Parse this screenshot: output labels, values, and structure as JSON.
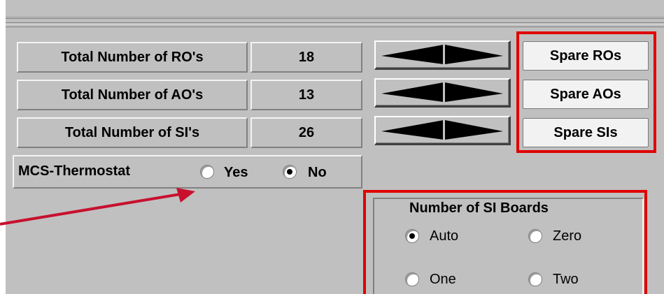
{
  "rows": [
    {
      "label": "Total Number of RO's",
      "value": "18",
      "spare": "Spare ROs"
    },
    {
      "label": "Total Number of AO's",
      "value": "13",
      "spare": "Spare AOs"
    },
    {
      "label": "Total Number of SI's",
      "value": "26",
      "spare": "Spare SIs"
    }
  ],
  "mcs": {
    "label": "MCS-Thermostat",
    "options": [
      {
        "label": "Yes",
        "selected": false
      },
      {
        "label": "No",
        "selected": true
      }
    ]
  },
  "si_boards": {
    "title": "Number of SI Boards",
    "options": [
      {
        "label": "Auto",
        "selected": true
      },
      {
        "label": "Zero",
        "selected": false
      },
      {
        "label": "One",
        "selected": false
      },
      {
        "label": "Two",
        "selected": false
      }
    ]
  },
  "colors": {
    "panel": "#c0c0c0",
    "highlight": "#e00000",
    "annotation_arrow": "#c8102e"
  }
}
